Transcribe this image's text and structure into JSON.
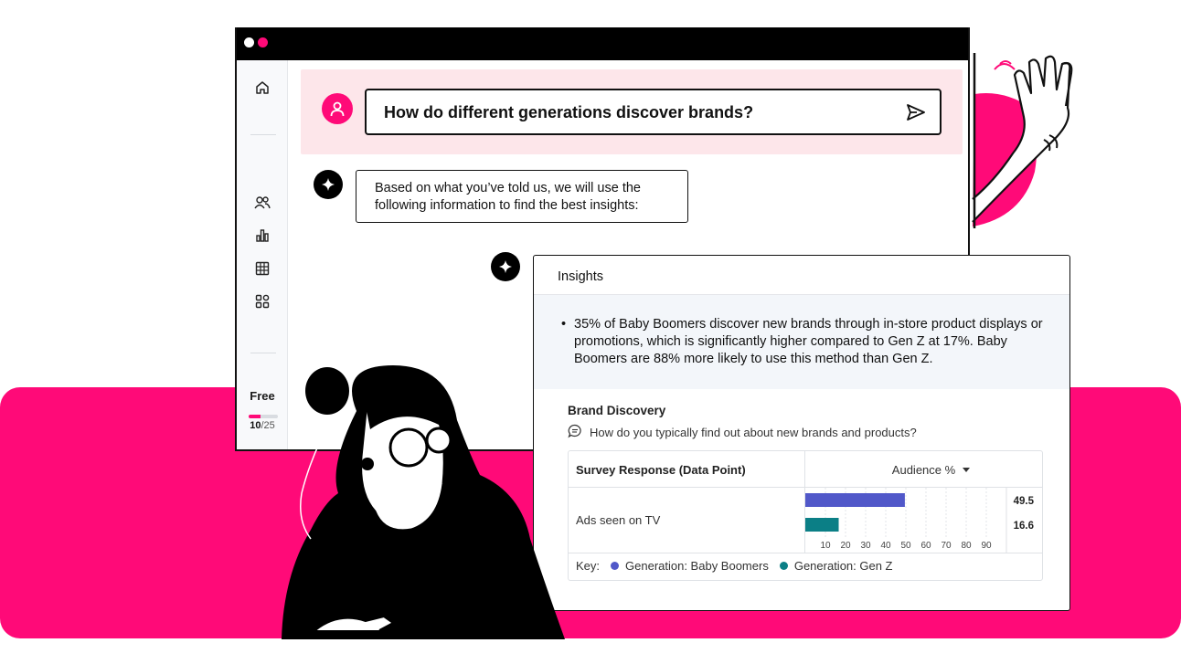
{
  "sidebar": {
    "icons": [
      "home-icon",
      "users-icon",
      "bar-chart-icon",
      "table-grid-icon",
      "apps-icon"
    ],
    "plan": {
      "label": "Free",
      "used": "10",
      "total": "/25",
      "progress": 0.4
    }
  },
  "question": {
    "text": "How do different generations discover brands?"
  },
  "assistant": {
    "message": "Based on what you’ve told us, we will use the following information to find the best insights:"
  },
  "insights": {
    "title": "Insights",
    "bullet": "35% of Baby Boomers discover new brands through in-store product displays or promotions, which is significantly higher compared to Gen Z at 17%. Baby Boomers are 88% more likely to use this method than Gen Z.",
    "section_title": "Brand Discovery",
    "question": "How do you typically find out about new brands and products?",
    "table": {
      "col_left": "Survey Response (Data Point)",
      "col_right": "Audience %",
      "row_label": "Ads seen on TV",
      "key_label": "Key:"
    }
  },
  "colors": {
    "accent": "#ff0a78",
    "baby_boomers": "#5158c9",
    "gen_z": "#0b7f86"
  },
  "chart_data": {
    "type": "bar",
    "orientation": "horizontal",
    "categories": [
      "Ads seen on TV"
    ],
    "series": [
      {
        "name": "Generation: Baby Boomers",
        "values": [
          49.5
        ],
        "color": "#5158c9"
      },
      {
        "name": "Generation: Gen Z",
        "values": [
          16.6
        ],
        "color": "#0b7f86"
      }
    ],
    "value_labels": [
      "49.5",
      "16.6"
    ],
    "xticks": [
      "10",
      "20",
      "30",
      "40",
      "50",
      "60",
      "70",
      "80",
      "90"
    ],
    "xlim": [
      0,
      100
    ],
    "grid": true,
    "legend": "bottom-left"
  }
}
